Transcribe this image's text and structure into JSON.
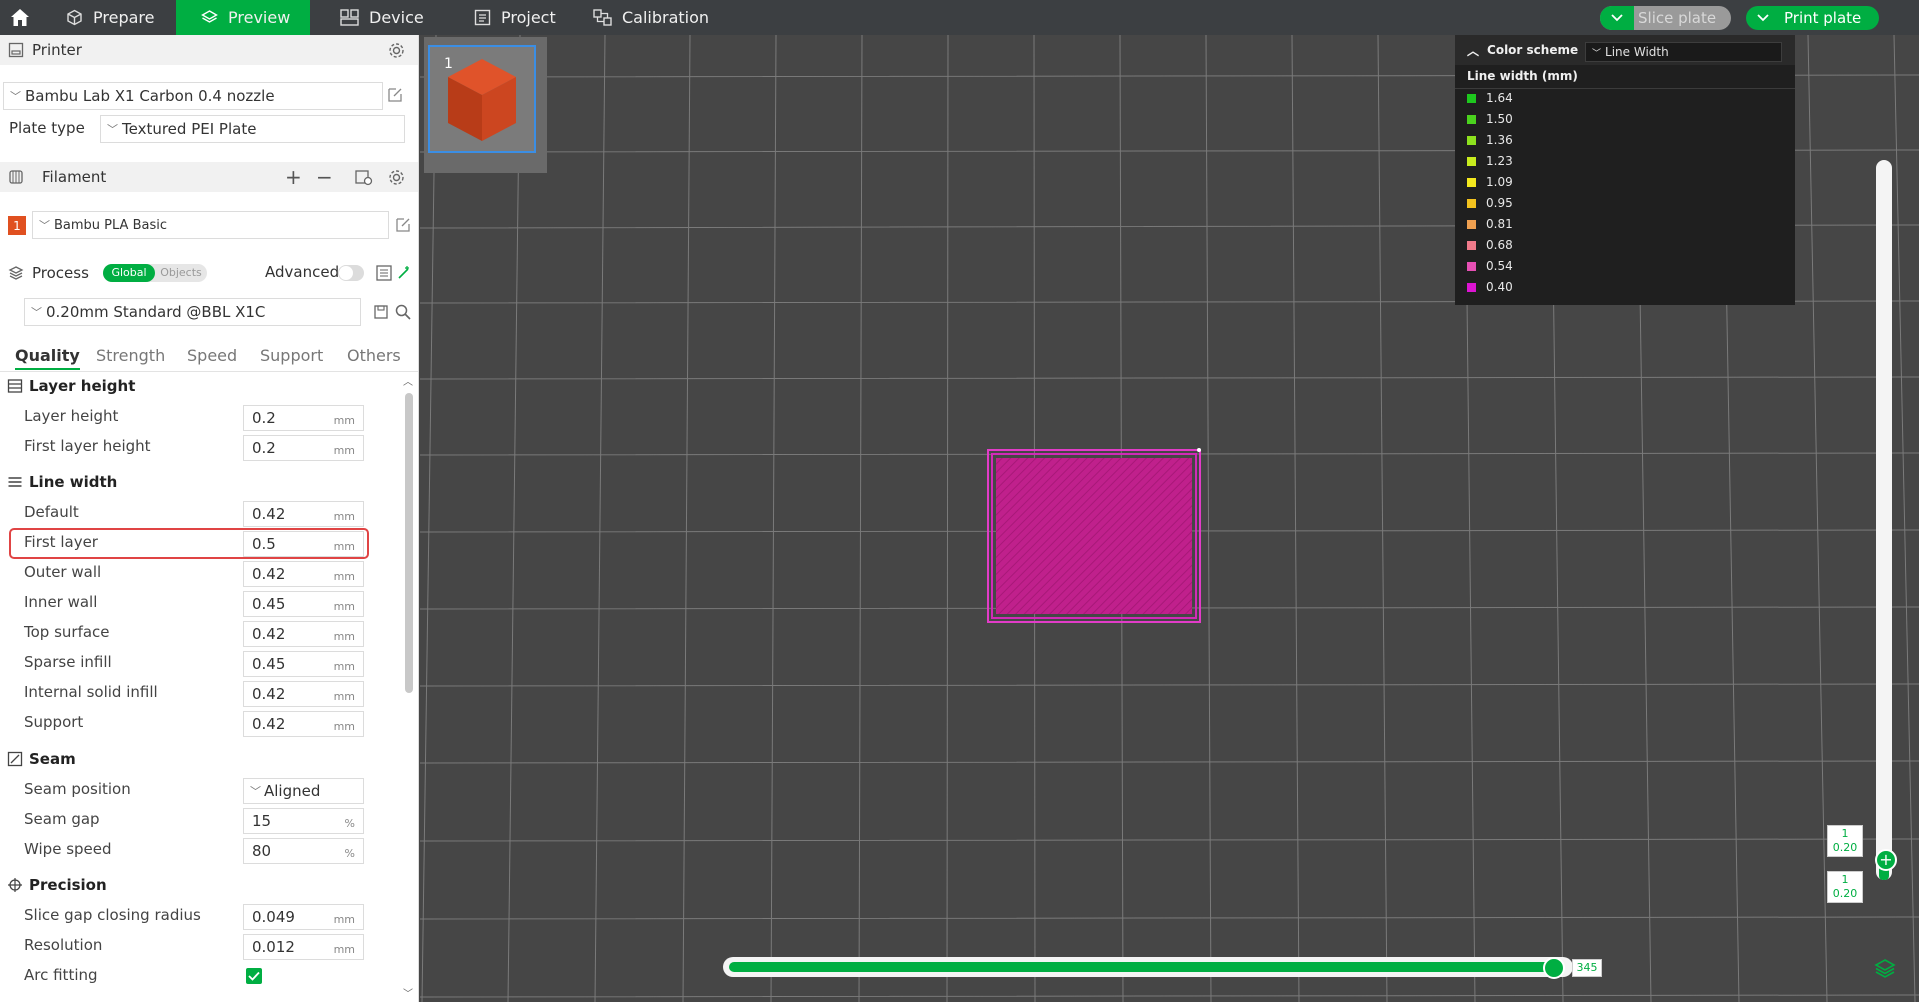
{
  "nav": {
    "tabs": [
      {
        "label": "Prepare"
      },
      {
        "label": "Preview"
      },
      {
        "label": "Device"
      },
      {
        "label": "Project"
      },
      {
        "label": "Calibration"
      }
    ],
    "slice_label": "Slice plate",
    "print_label": "Print plate"
  },
  "printer": {
    "section_label": "Printer",
    "model": "Bambu Lab X1 Carbon 0.4 nozzle",
    "plate_type_label": "Plate type",
    "plate_type": "Textured PEI Plate"
  },
  "filament": {
    "section_label": "Filament",
    "slot": "1",
    "name": "Bambu PLA Basic"
  },
  "process": {
    "section_label": "Process",
    "toggle_global": "Global",
    "toggle_objects": "Objects",
    "advanced_label": "Advanced",
    "preset": "0.20mm Standard @BBL X1C"
  },
  "tabs": [
    "Quality",
    "Strength",
    "Speed",
    "Support",
    "Others"
  ],
  "groups": {
    "layer_height": {
      "title": "Layer height",
      "rows": [
        {
          "label": "Layer height",
          "value": "0.2",
          "unit": "mm"
        },
        {
          "label": "First layer height",
          "value": "0.2",
          "unit": "mm"
        }
      ]
    },
    "line_width": {
      "title": "Line width",
      "rows": [
        {
          "label": "Default",
          "value": "0.42",
          "unit": "mm"
        },
        {
          "label": "First layer",
          "value": "0.5",
          "unit": "mm"
        },
        {
          "label": "Outer wall",
          "value": "0.42",
          "unit": "mm"
        },
        {
          "label": "Inner wall",
          "value": "0.45",
          "unit": "mm"
        },
        {
          "label": "Top surface",
          "value": "0.42",
          "unit": "mm"
        },
        {
          "label": "Sparse infill",
          "value": "0.45",
          "unit": "mm"
        },
        {
          "label": "Internal solid infill",
          "value": "0.42",
          "unit": "mm"
        },
        {
          "label": "Support",
          "value": "0.42",
          "unit": "mm"
        }
      ]
    },
    "seam": {
      "title": "Seam",
      "rows": [
        {
          "label": "Seam position",
          "value": "Aligned",
          "unit": ""
        },
        {
          "label": "Seam gap",
          "value": "15",
          "unit": "%"
        },
        {
          "label": "Wipe speed",
          "value": "80",
          "unit": "%"
        }
      ]
    },
    "precision": {
      "title": "Precision",
      "rows": [
        {
          "label": "Slice gap closing radius",
          "value": "0.049",
          "unit": "mm"
        },
        {
          "label": "Resolution",
          "value": "0.012",
          "unit": "mm"
        },
        {
          "label": "Arc fitting",
          "checked": true
        }
      ]
    }
  },
  "viewport": {
    "plate_number": "1",
    "legend": {
      "header": "Color scheme",
      "scheme": "Line Width",
      "title": "Line width (mm)",
      "items": [
        {
          "value": "1.64",
          "color": "#1ec81e"
        },
        {
          "value": "1.50",
          "color": "#4bd21e"
        },
        {
          "value": "1.36",
          "color": "#8ee11e"
        },
        {
          "value": "1.23",
          "color": "#c8ec1e"
        },
        {
          "value": "1.09",
          "color": "#f3e81e"
        },
        {
          "value": "0.95",
          "color": "#f3c21e"
        },
        {
          "value": "0.81",
          "color": "#f0a050"
        },
        {
          "value": "0.68",
          "color": "#f07a8a"
        },
        {
          "value": "0.54",
          "color": "#e650b4"
        },
        {
          "value": "0.40",
          "color": "#dc14d2"
        }
      ]
    },
    "layer_top": {
      "layer": "1",
      "height": "0.20"
    },
    "layer_bottom": {
      "layer": "1",
      "height": "0.20"
    },
    "move_position": "345",
    "accent_color": "#00ae42",
    "highlight_color": "#e04444"
  }
}
